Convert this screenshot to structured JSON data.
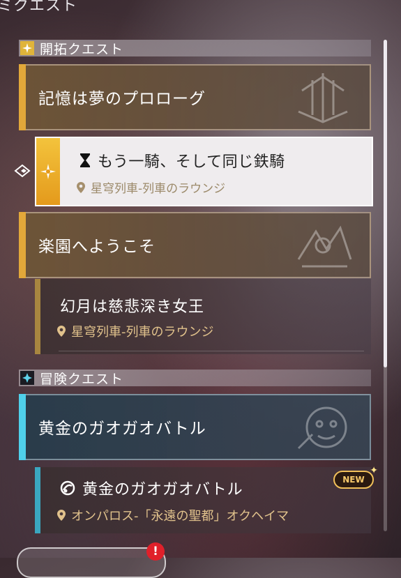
{
  "page_title": "ミクエスト",
  "sections": {
    "trailblaze": {
      "label": "開拓クエスト",
      "icon": "compass-star-icon",
      "accent": "#e2a83a"
    },
    "adventure": {
      "label": "冒険クエスト",
      "icon": "diamond-star-icon",
      "accent": "#4fd0ea"
    }
  },
  "groups": {
    "memory": {
      "title": "記憶は夢のプロローグ",
      "emblem": "chapter-emblem-icon"
    },
    "paradise": {
      "title": "楽園へようこそ",
      "emblem": "chapter-emblem-icon"
    },
    "golden": {
      "title": "黄金のガオガオバトル",
      "emblem": "beast-emblem-icon"
    }
  },
  "quests": {
    "selected": {
      "name": "もう一騎、そして同じ鉄騎",
      "location": "星穹列車-列車のラウンジ",
      "status_icon": "hourglass-icon",
      "selected": true
    },
    "moon": {
      "name": "幻月は慈悲深き女王",
      "location": "星穹列車-列車のラウンジ"
    },
    "golden_battle": {
      "name": "黄金のガオガオバトル",
      "location": "オンパロス-「永遠の聖都」オクヘイマ",
      "status_icon": "adventure-quest-icon",
      "badge": "NEW"
    }
  },
  "alert": "!"
}
